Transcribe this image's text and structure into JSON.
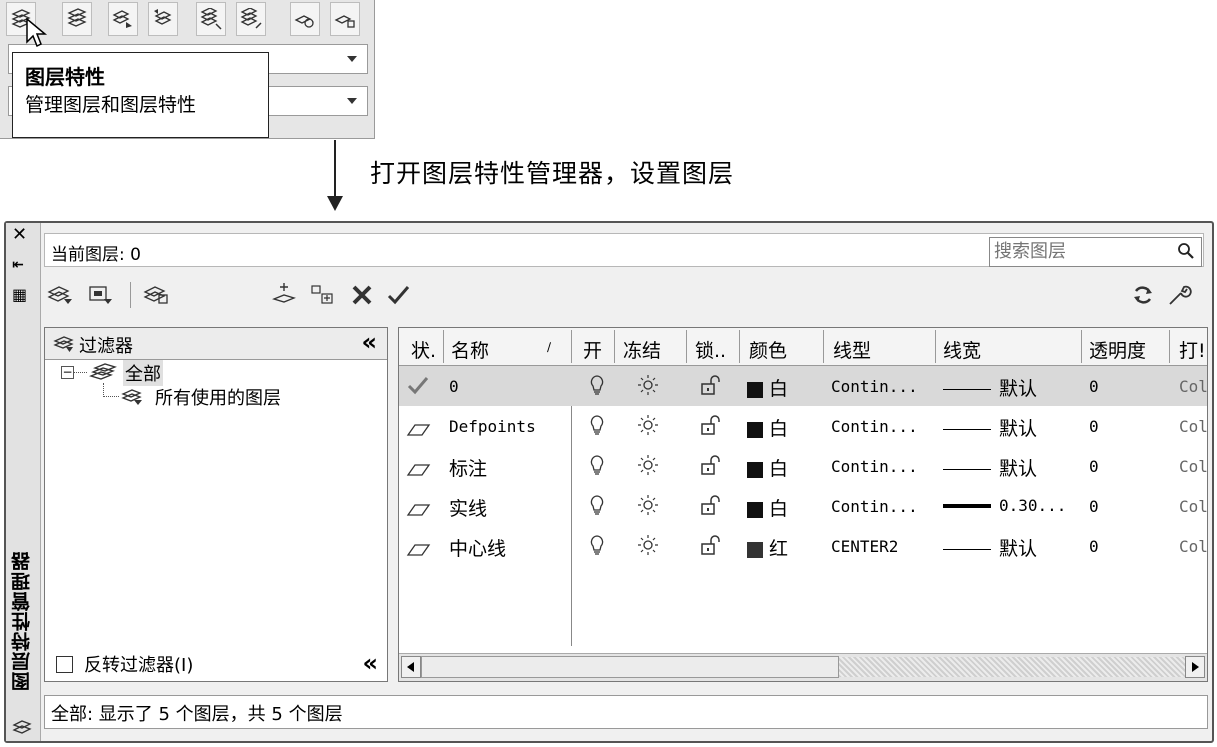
{
  "ribbon": {
    "buttons": [
      "layer-properties-icon",
      "layer-state-icon",
      "layer-isolate-icon",
      "layer-unisolate-icon",
      "layer-freeze-icon",
      "layer-off-icon",
      "layer-match-icon",
      "layer-lock-icon"
    ]
  },
  "tooltip": {
    "title": "图层特性",
    "description": "管理图层和图层特性"
  },
  "caption": "打开图层特性管理器，设置图层",
  "palette": {
    "vertical_title": "图层特性管理器",
    "current_layer_label": "当前图层: 0",
    "search_placeholder": "搜索图层",
    "filter_pane": {
      "header": "过滤器",
      "tree": [
        {
          "label": "全部"
        },
        {
          "label": "所有使用的图层"
        }
      ],
      "invert_label": "反转过滤器(I)"
    },
    "columns": [
      "状.",
      "名称",
      "开",
      "冻结",
      "锁..",
      "颜色",
      "线型",
      "线宽",
      "透明度",
      "打!"
    ],
    "rows": [
      {
        "name": "0",
        "color": "白",
        "color_hex": "#111111",
        "linetype": "Contin...",
        "lineweight": "默认",
        "transparency": "0",
        "plot": "Col",
        "current": true
      },
      {
        "name": "Defpoints",
        "color": "白",
        "color_hex": "#111111",
        "linetype": "Contin...",
        "lineweight": "默认",
        "transparency": "0",
        "plot": "Col",
        "current": false
      },
      {
        "name": "标注",
        "color": "白",
        "color_hex": "#111111",
        "linetype": "Contin...",
        "lineweight": "默认",
        "transparency": "0",
        "plot": "Col",
        "current": false
      },
      {
        "name": "实线",
        "color": "白",
        "color_hex": "#111111",
        "linetype": "Contin...",
        "lineweight": "0.30...",
        "transparency": "0",
        "plot": "Col",
        "current": false
      },
      {
        "name": "中心线",
        "color": "红",
        "color_hex": "#333333",
        "linetype": "CENTER2",
        "lineweight": "默认",
        "transparency": "0",
        "plot": "Col",
        "current": false
      }
    ],
    "status": "全部: 显示了 5 个图层，共 5 个图层"
  }
}
